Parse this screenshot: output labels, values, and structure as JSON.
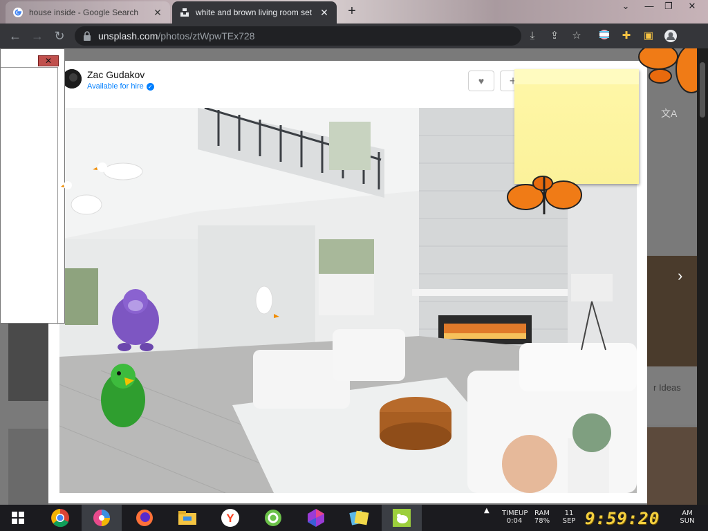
{
  "browser": {
    "tabs": [
      {
        "title": "house inside - Google Search",
        "favicon": "google-g-icon",
        "active": false
      },
      {
        "title": "white and brown living room set",
        "favicon": "unsplash-icon",
        "active": true
      }
    ],
    "new_tab": "+",
    "window_controls": {
      "minimize": "—",
      "restore": "❐",
      "close": "✕",
      "tablist": "⌄"
    },
    "url_host": "unsplash.com",
    "url_path": "/photos/ztWpwTEx728"
  },
  "photo_page": {
    "author": {
      "name": "Zac Gudakov",
      "status": "Available for hire"
    },
    "like_label": "♥",
    "add_label": "+",
    "next_label": "›",
    "ideas_label": "r Ideas"
  },
  "side_panel": {
    "close_label": "✕"
  },
  "taskbar": {
    "apps": [
      "windows-start-icon",
      "chrome-icon",
      "pinwheel-icon",
      "firefox-icon",
      "file-explorer-icon",
      "yandex-browser-icon",
      "mobile-app-icon",
      "gem-app-icon",
      "cards-app-icon",
      "desktop-pet-app-icon"
    ],
    "tray": {
      "uptime_label": "TIMEUP",
      "uptime_value": "0:04",
      "ram_label": "RAM",
      "ram_value": "78%",
      "date_day": "11",
      "date_month": "SEP",
      "ampm": "AM",
      "weekday": "SUN"
    },
    "clock": "9:59:20"
  },
  "colors": {
    "unsplash_blue": "#007fff",
    "sticky_yellow": "#fbf29a",
    "close_red": "#c0504d",
    "clock_yellow": "#f4d03f"
  }
}
